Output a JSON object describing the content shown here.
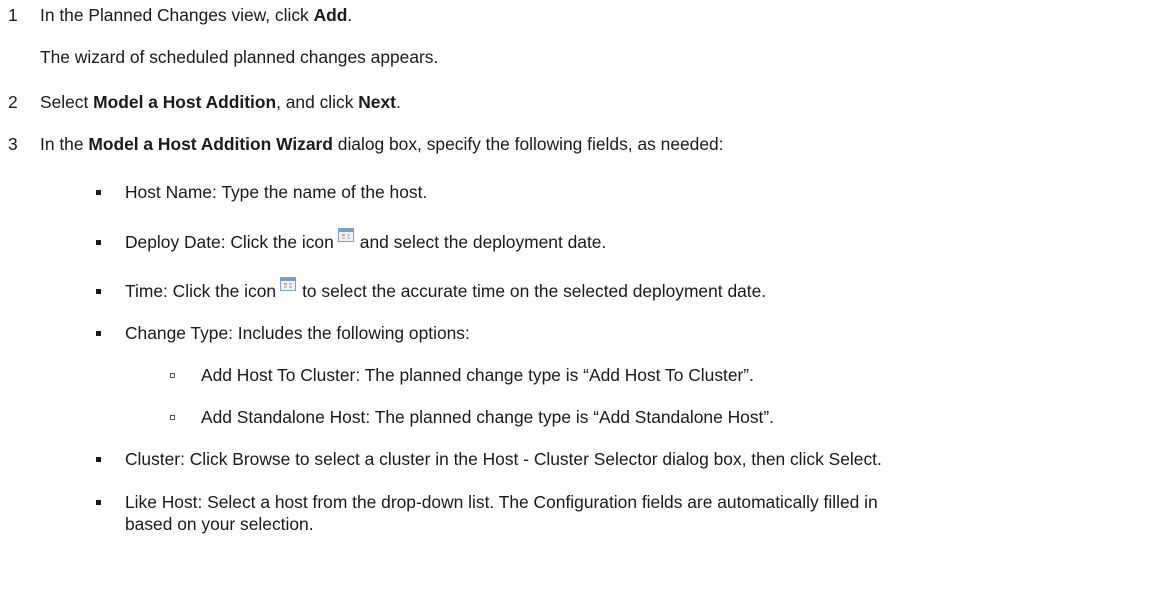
{
  "steps": [
    {
      "number": "1",
      "pre": "In the Planned Changes view, click ",
      "bold": "Add",
      "post": "."
    },
    {
      "note": "The wizard of scheduled planned changes appears."
    },
    {
      "number": "2",
      "pre": "Select ",
      "bold1": "Model a Host Addition",
      "mid": ", and click ",
      "bold2": "Next",
      "post": "."
    },
    {
      "number": "3",
      "pre": "In the ",
      "bold": "Model a Host Addition Wizard",
      "post": " dialog box, specify the following fields, as needed:"
    }
  ],
  "fields": {
    "host_name": "Host Name: Type the name of the host.",
    "deploy_date_pre": "Deploy Date: Click the icon",
    "deploy_date_post": "and select the deployment date.",
    "time_pre": "Time: Click the icon",
    "time_post": "to select the accurate time on the selected deployment date.",
    "change_type": "Change Type: Includes the following options:",
    "option_cluster": "Add Host To Cluster: The planned change type is “Add Host To Cluster”.",
    "option_standalone": "Add Standalone Host: The planned change type is “Add Standalone Host”.",
    "cluster": "Cluster: Click Browse to select a cluster in the Host - Cluster Selector dialog box, then click Select.",
    "like_host_line1": "Like Host: Select a host from the drop-down list. The Configuration fields are automatically filled in",
    "like_host_line2": "based on your selection."
  },
  "icons": {
    "calendar": "calendar-icon"
  }
}
